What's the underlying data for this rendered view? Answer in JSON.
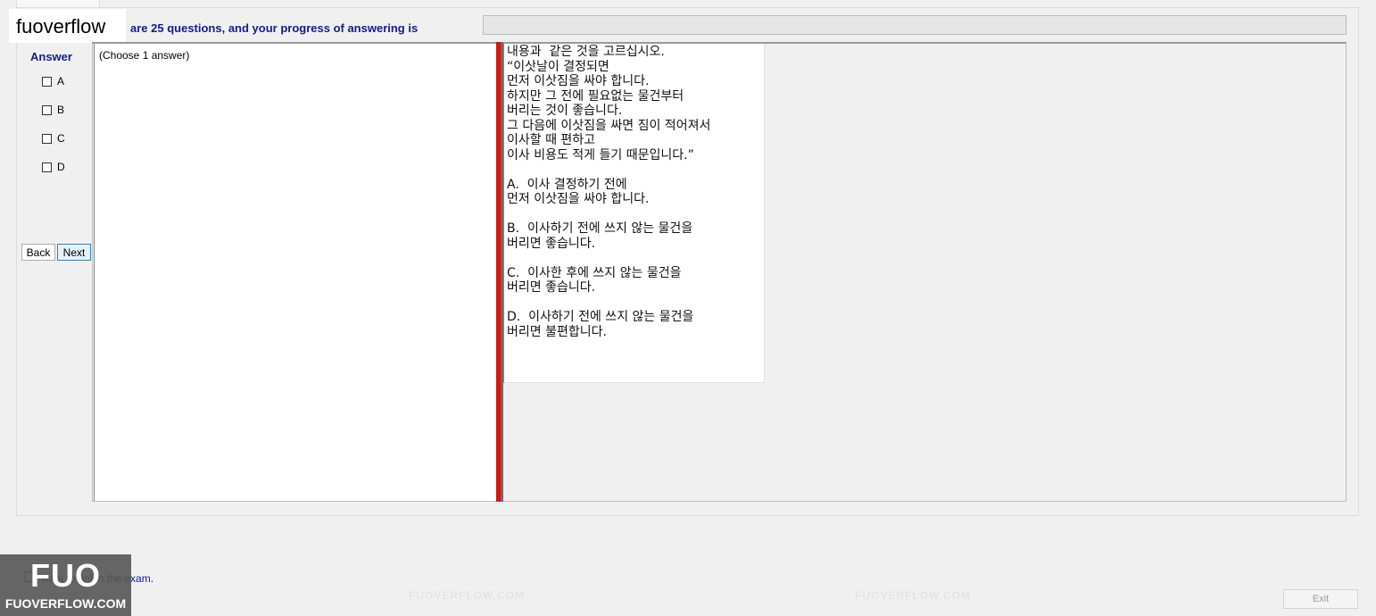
{
  "brand": "fuoverflow",
  "progress": {
    "label": "are 25 questions, and your progress of answering is",
    "fraction": 0.0
  },
  "answer": {
    "heading": "Answer",
    "choices": [
      "A",
      "B",
      "C",
      "D"
    ],
    "instruction": "(Choose 1 answer)"
  },
  "nav": {
    "back_label": "Back",
    "next_label": "Next"
  },
  "question": {
    "text": "내용과  같은 것을 고르십시오.\n“이삿날이 결정되면\n먼저 이삿짐을 싸야 합니다.\n하지만 그 전에 필요없는 물건부터\n버리는 것이 좋습니다.\n그 다음에 이삿짐을 싸면 짐이 적어져서\n이사할 때 편하고\n이사 비용도 적게 들기 때문입니다.”\n\nA.  이사 결정하기 전에\n먼저 이삿짐을 싸야 합니다.\n\nB.  이사하기 전에 쓰지 않는 물건을\n버리면 좋습니다.\n\nC.  이사한 후에 쓰지 않는 물건을\n버리면 좋습니다.\n\nD.  이사하기 전에 쓰지 않는 물건을\n버리면 불편합니다."
  },
  "finish": {
    "label": "want to finish the exam."
  },
  "logo": {
    "big": "FUO",
    "site": "FUOVERFLOW.COM"
  },
  "watermark": "FUOVERFLOW.COM",
  "exit_label": "Exit",
  "colors": {
    "accent_text": "#1a1a8c",
    "splitter": "#d51515"
  }
}
